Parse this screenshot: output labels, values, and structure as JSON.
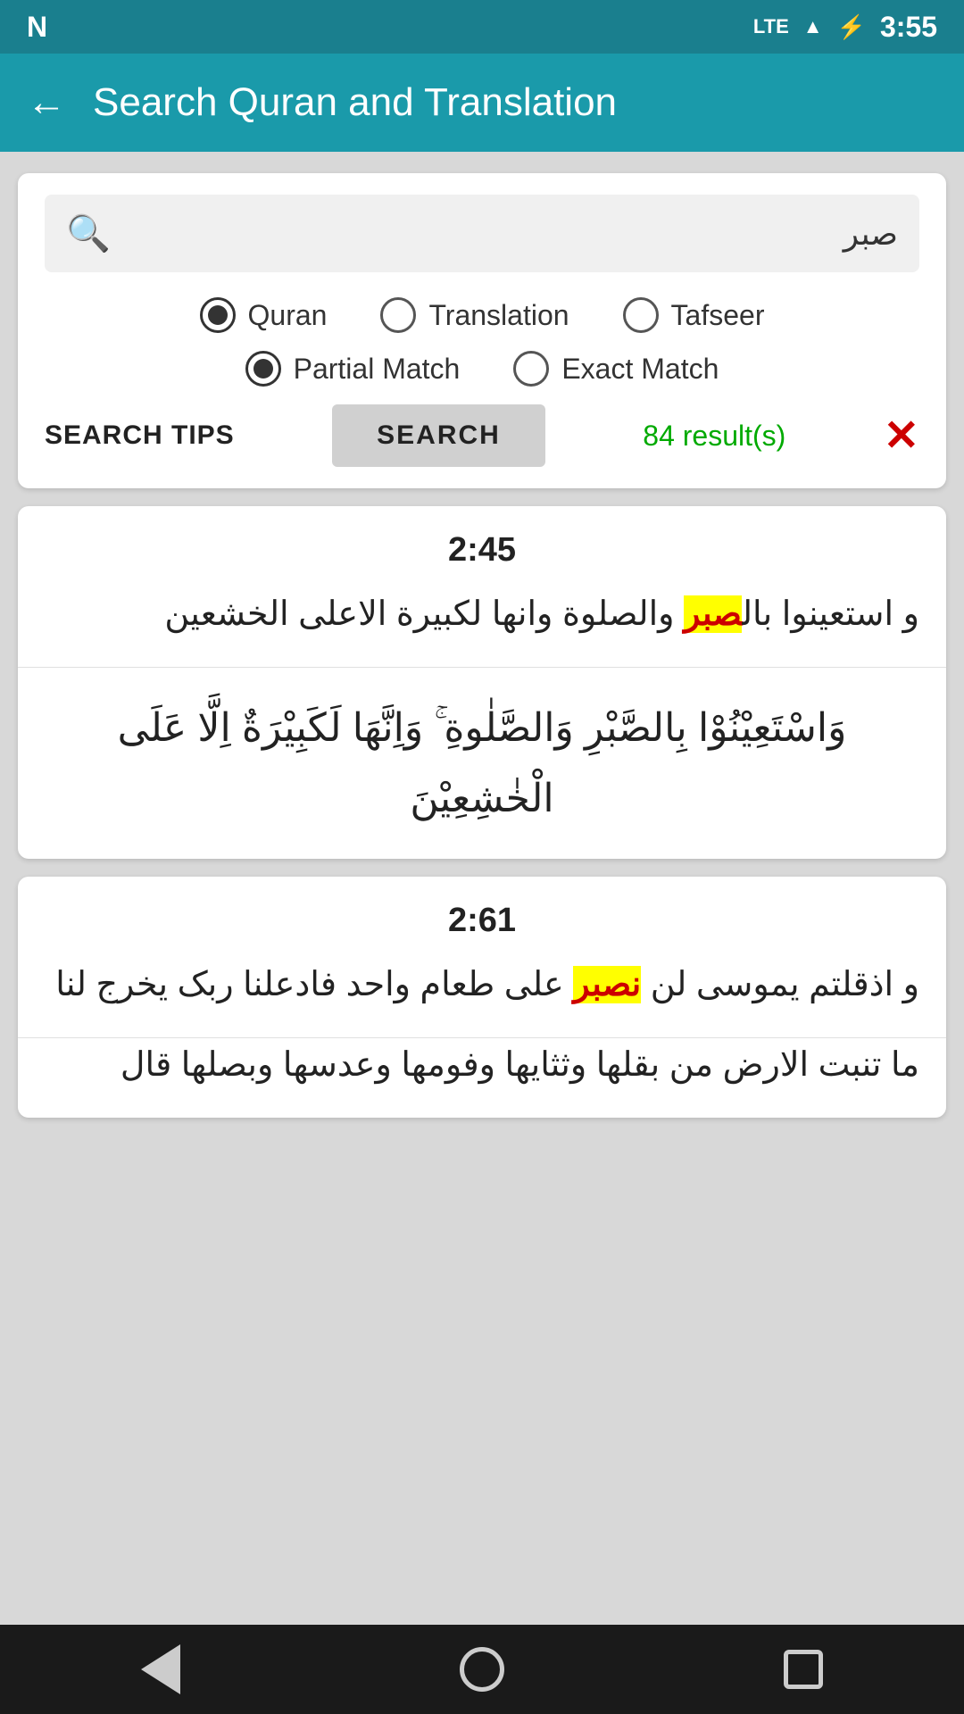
{
  "statusBar": {
    "lte": "LTE",
    "time": "3:55"
  },
  "toolbar": {
    "title": "Search Quran and Translation",
    "backLabel": "←"
  },
  "searchCard": {
    "inputText": "صبر",
    "searchIconLabel": "🔍",
    "radioOptions": [
      {
        "id": "quran",
        "label": "Quran",
        "selected": true
      },
      {
        "id": "translation",
        "label": "Translation",
        "selected": false
      },
      {
        "id": "tafseer",
        "label": "Tafseer",
        "selected": false
      }
    ],
    "matchOptions": [
      {
        "id": "partial",
        "label": "Partial Match",
        "selected": true
      },
      {
        "id": "exact",
        "label": "Exact Match",
        "selected": false
      }
    ],
    "searchTipsLabel": "SEARCH TIPS",
    "searchButtonLabel": "SEARCH",
    "resultCount": "84 result(s)",
    "clearLabel": "✕"
  },
  "verses": [
    {
      "ref": "2:45",
      "simpleArabicPre": "و استعینوا بال",
      "simpleArabicHighlight": "صبر",
      "simpleArabicPost": " والصلوة وانها لکبیرة الاعلی الخشعین",
      "calligraphy": "وَاسْتَعِيْنُوْا بِالصَّبْرِ وَالصَّلٰوةِ ۚ وَاِنَّهَا لَكَبِيْرَةٌ اِلَّا عَلَى الْخٰشِعِيْنَ"
    },
    {
      "ref": "2:61",
      "simpleArabicPre": "و اذقلتم یموسی لن ",
      "simpleArabicHighlight": "نصبر",
      "simpleArabicPost": " علی طعام واحد فادعلنا ربک یخرج لنا",
      "line2": "ما تنبت الارض من بقلها وثثایها وفومها وعدسها وبصلها قال",
      "line3": ""
    }
  ]
}
